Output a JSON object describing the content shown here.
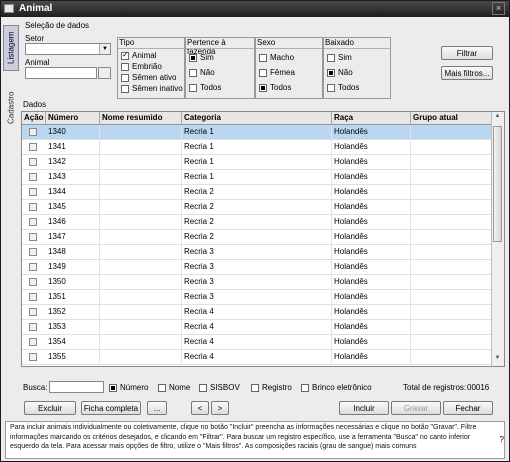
{
  "window": {
    "title": "Animal"
  },
  "side_tabs": [
    "Listagem",
    "Cadastro"
  ],
  "selection": {
    "heading": "Seleção de dados",
    "setor_label": "Setor",
    "setor_value": "",
    "animal_label": "Animal",
    "animal_value": ""
  },
  "filters": {
    "tipo": {
      "title": "Tipo",
      "options": [
        {
          "label": "Animal",
          "state": "checked"
        },
        {
          "label": "Embrião",
          "state": "none"
        },
        {
          "label": "Sêmen ativo",
          "state": "none"
        },
        {
          "label": "Sêmen inativo",
          "state": "none"
        }
      ]
    },
    "fazenda": {
      "title": "Pertence à fazenda",
      "options": [
        {
          "label": "Sim",
          "state": "filled"
        },
        {
          "label": "Não",
          "state": "none"
        },
        {
          "label": "Todos",
          "state": "none"
        }
      ]
    },
    "sexo": {
      "title": "Sexo",
      "options": [
        {
          "label": "Macho",
          "state": "none"
        },
        {
          "label": "Fêmea",
          "state": "none"
        },
        {
          "label": "Todos",
          "state": "filled"
        }
      ]
    },
    "baixado": {
      "title": "Baixado",
      "options": [
        {
          "label": "Sim",
          "state": "none"
        },
        {
          "label": "Não",
          "state": "filled"
        },
        {
          "label": "Todos",
          "state": "none"
        }
      ]
    }
  },
  "buttons": {
    "filtrar": "Filtrar",
    "mais_filtros": "Mais filtros...",
    "excluir": "Excluir",
    "ficha": "Ficha completa",
    "dots": "...",
    "prev": "<",
    "next": ">",
    "incluir": "Incluir",
    "gravar": "Gravar",
    "fechar": "Fechar"
  },
  "grid": {
    "title": "Dados",
    "columns": [
      "Ação",
      "Número",
      "Nome resumido",
      "Categoria",
      "Raça",
      "Grupo atual"
    ],
    "rows": [
      {
        "numero": "1340",
        "nome": "",
        "categoria": "Recria 1",
        "raca": "Holandês",
        "grupo": ""
      },
      {
        "numero": "1341",
        "nome": "",
        "categoria": "Recria 1",
        "raca": "Holandês",
        "grupo": ""
      },
      {
        "numero": "1342",
        "nome": "",
        "categoria": "Recria 1",
        "raca": "Holandês",
        "grupo": ""
      },
      {
        "numero": "1343",
        "nome": "",
        "categoria": "Recria 1",
        "raca": "Holandês",
        "grupo": ""
      },
      {
        "numero": "1344",
        "nome": "",
        "categoria": "Recria 2",
        "raca": "Holandês",
        "grupo": ""
      },
      {
        "numero": "1345",
        "nome": "",
        "categoria": "Recria 2",
        "raca": "Holandês",
        "grupo": ""
      },
      {
        "numero": "1346",
        "nome": "",
        "categoria": "Recria 2",
        "raca": "Holandês",
        "grupo": ""
      },
      {
        "numero": "1347",
        "nome": "",
        "categoria": "Recria 2",
        "raca": "Holandês",
        "grupo": ""
      },
      {
        "numero": "1348",
        "nome": "",
        "categoria": "Recria 3",
        "raca": "Holandês",
        "grupo": ""
      },
      {
        "numero": "1349",
        "nome": "",
        "categoria": "Recria 3",
        "raca": "Holandês",
        "grupo": ""
      },
      {
        "numero": "1350",
        "nome": "",
        "categoria": "Recria 3",
        "raca": "Holandês",
        "grupo": ""
      },
      {
        "numero": "1351",
        "nome": "",
        "categoria": "Recria 3",
        "raca": "Holandês",
        "grupo": ""
      },
      {
        "numero": "1352",
        "nome": "",
        "categoria": "Recria 4",
        "raca": "Holandês",
        "grupo": ""
      },
      {
        "numero": "1353",
        "nome": "",
        "categoria": "Recria 4",
        "raca": "Holandês",
        "grupo": ""
      },
      {
        "numero": "1354",
        "nome": "",
        "categoria": "Recria 4",
        "raca": "Holandês",
        "grupo": ""
      },
      {
        "numero": "1355",
        "nome": "",
        "categoria": "Recria 4",
        "raca": "Holandês",
        "grupo": ""
      }
    ]
  },
  "search": {
    "label": "Busca:",
    "value": "",
    "options": [
      {
        "label": "Número",
        "state": "filled"
      },
      {
        "label": "Nome",
        "state": "none"
      },
      {
        "label": "SISBOV",
        "state": "none"
      },
      {
        "label": "Registro",
        "state": "none"
      },
      {
        "label": "Brinco eletrônico",
        "state": "none"
      }
    ],
    "total_label": "Total de registros:",
    "total_value": "00016"
  },
  "help": {
    "text": "Para incluir animais individualmente ou coletivamente, clique no botão \"Incluir\" preencha as informações necessárias e clique no botão \"Gravar\". Filtre informações marcando os critérios desejados, e clicando em \"Filtrar\". Para buscar um registro específico, use a ferramenta \"Busca\" no canto inferior esquerdo da tela. Para acessar mais opções de filtro, utilize o \"Mais filtros\". As composições raciais (grau de sangue) mais comuns",
    "q": "?"
  }
}
